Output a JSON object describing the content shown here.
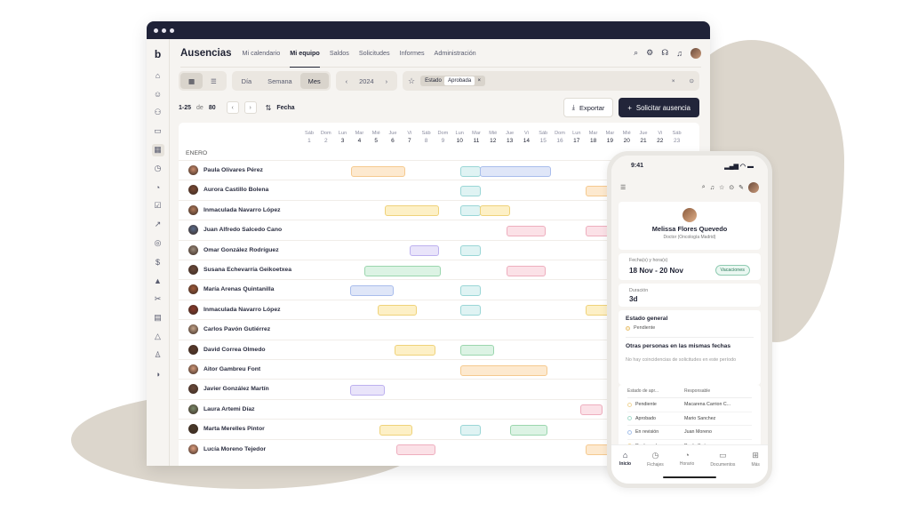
{
  "app": {
    "title": "Ausencias",
    "tabs": [
      "Mi calendario",
      "Mi equipo",
      "Saldos",
      "Solicitudes",
      "Informes",
      "Administración"
    ],
    "active_tab": "Mi equipo"
  },
  "toolbar": {
    "view_options": [
      "Día",
      "Semana",
      "Mes"
    ],
    "active_view": "Mes",
    "year": "2024",
    "filter_label": "Estado",
    "filter_value": "Aprobada",
    "range": "1-25",
    "of": "de",
    "total": "80",
    "sort_label": "Fecha",
    "export_label": "Exportar",
    "request_label": "Solicitar ausencia"
  },
  "calendar": {
    "month": "ENERO",
    "days": [
      {
        "w": "Sáb",
        "n": "1",
        "we": true
      },
      {
        "w": "Dom",
        "n": "2",
        "we": true
      },
      {
        "w": "Lun",
        "n": "3"
      },
      {
        "w": "Mar",
        "n": "4"
      },
      {
        "w": "Mié",
        "n": "5"
      },
      {
        "w": "Jue",
        "n": "6"
      },
      {
        "w": "Vi",
        "n": "7"
      },
      {
        "w": "Sáb",
        "n": "8",
        "we": true
      },
      {
        "w": "Dom",
        "n": "9",
        "we": true
      },
      {
        "w": "Lun",
        "n": "10"
      },
      {
        "w": "Mar",
        "n": "11"
      },
      {
        "w": "Mié",
        "n": "12"
      },
      {
        "w": "Jue",
        "n": "13"
      },
      {
        "w": "Vi",
        "n": "14"
      },
      {
        "w": "Sáb",
        "n": "15",
        "we": true
      },
      {
        "w": "Dom",
        "n": "16",
        "we": true
      },
      {
        "w": "Lun",
        "n": "17"
      },
      {
        "w": "Mar",
        "n": "18"
      },
      {
        "w": "Mar",
        "n": "19"
      },
      {
        "w": "Mié",
        "n": "20"
      },
      {
        "w": "Jue",
        "n": "21"
      },
      {
        "w": "Vi",
        "n": "22"
      },
      {
        "w": "Sáb",
        "n": "23",
        "we": true
      }
    ],
    "people": [
      {
        "name": "Paula Olivares Pérez",
        "bars": [
          [
            3,
            5.8,
            "orange"
          ],
          [
            9.5,
            10.3,
            "teal"
          ],
          [
            10.7,
            14.5,
            "blue"
          ]
        ]
      },
      {
        "name": "Aurora Castillo Bolena",
        "bars": [
          [
            9.5,
            10.3,
            "teal"
          ],
          [
            17,
            18.5,
            "orange"
          ]
        ]
      },
      {
        "name": "Inmaculada Navarro López",
        "bars": [
          [
            5,
            7.8,
            "yellow"
          ],
          [
            9.5,
            10.3,
            "teal"
          ],
          [
            10.7,
            12.1,
            "yellow"
          ]
        ]
      },
      {
        "name": "Juan Alfredo Salcedo Cano",
        "bars": [
          [
            12.3,
            14.2,
            "pink"
          ],
          [
            17,
            18.5,
            "pink"
          ]
        ]
      },
      {
        "name": "Omar González Rodríguez",
        "bars": [
          [
            6.5,
            7.8,
            "purple"
          ],
          [
            9.5,
            10.3,
            "teal"
          ]
        ]
      },
      {
        "name": "Susana Echevarría Geikoetxea",
        "bars": [
          [
            3.8,
            7.9,
            "green"
          ],
          [
            12.3,
            14.2,
            "pink"
          ]
        ]
      },
      {
        "name": "María Arenas Quintanilla",
        "bars": [
          [
            2.9,
            5.1,
            "blue"
          ],
          [
            9.5,
            10.3,
            "teal"
          ]
        ]
      },
      {
        "name": "Inmaculada Navarro López",
        "bars": [
          [
            4.6,
            6.5,
            "yellow"
          ],
          [
            9.5,
            10.3,
            "teal"
          ],
          [
            17,
            18.5,
            "yellow"
          ]
        ]
      },
      {
        "name": "Carlos Pavón Gutiérrez",
        "bars": []
      },
      {
        "name": "David Correa Olmedo",
        "bars": [
          [
            5.6,
            7.6,
            "yellow"
          ],
          [
            9.5,
            11.1,
            "green"
          ]
        ]
      },
      {
        "name": "Aitor Gambreu Font",
        "bars": [
          [
            9.5,
            14.3,
            "orange"
          ]
        ]
      },
      {
        "name": "Javier González Martín",
        "bars": [
          [
            2.9,
            4.6,
            "purple"
          ]
        ]
      },
      {
        "name": "Laura Artemi Díaz",
        "bars": [
          [
            16.7,
            17.6,
            "pink"
          ]
        ]
      },
      {
        "name": "Marta Merelles Pintor",
        "bars": [
          [
            4.7,
            6.2,
            "yellow"
          ],
          [
            9.5,
            10.3,
            "teal"
          ],
          [
            12.5,
            14.3,
            "green"
          ]
        ]
      },
      {
        "name": "Lucía Moreno Tejedor",
        "bars": [
          [
            5.7,
            7.6,
            "pink"
          ],
          [
            17,
            18.5,
            "orange"
          ]
        ]
      }
    ]
  },
  "palette": {
    "orange": [
      "#fde9cf",
      "#f5c98f"
    ],
    "teal": [
      "#dff3f3",
      "#9ad6d6"
    ],
    "blue": [
      "#dfe6f8",
      "#a9bdec"
    ],
    "yellow": [
      "#fdf0c6",
      "#efd27a"
    ],
    "pink": [
      "#fbe1e7",
      "#eeaebe"
    ],
    "purple": [
      "#e9e4fa",
      "#bdb1ef"
    ],
    "green": [
      "#dcf3e4",
      "#9bd6ae"
    ]
  },
  "phone": {
    "time": "9:41",
    "user_name": "Melissa Flores Quevedo",
    "user_role": "Doctor (Oncología Madrid)",
    "dates_label": "Fecha(s) y hora(s)",
    "dates_value": "18 Nov - 20 Nov",
    "type_badge": "Vacaciones",
    "duration_label": "Duración",
    "duration_value": "3d",
    "general_status_title": "Estado general",
    "general_status_value": "Pendiente",
    "others_title": "Otras personas en las mismas fechas",
    "others_empty": "No hay coincidencias de solicitudes en este período",
    "approval_col_state": "Estado de apr...",
    "approval_col_resp": "Responsable",
    "approvals": [
      {
        "state": "Pendiente",
        "resp": "Macarena Carrion C...",
        "color": "#f1d79a"
      },
      {
        "state": "Aprobado",
        "resp": "Mario Sanchez",
        "color": "#a8dccd"
      },
      {
        "state": "En revisión",
        "resp": "Juan Moreno",
        "color": "#a9c3ec"
      },
      {
        "state": "Rechazado",
        "resp": "Paula Suárez",
        "color": "#f1d79a"
      }
    ],
    "tabs": [
      "Inicio",
      "Fichajes",
      "Horario",
      "Documentos",
      "Más"
    ]
  }
}
